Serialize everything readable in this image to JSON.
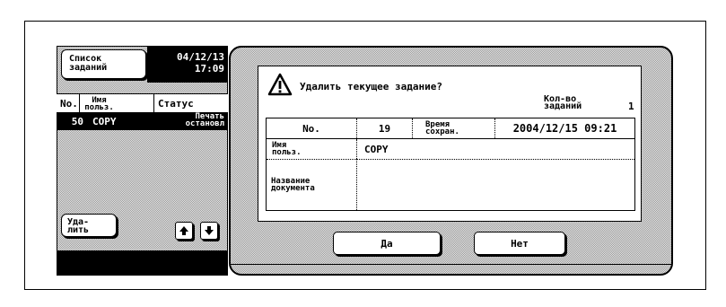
{
  "job_panel": {
    "list_button_line1": "Список",
    "list_button_line2": "заданий",
    "date": "04/12/13",
    "time": "17:09",
    "header": {
      "no": "No.",
      "user_line1": "Имя",
      "user_line2": "польз.",
      "status": "Статус"
    },
    "jobs": [
      {
        "no": "50",
        "user": "COPY",
        "status_line1": "Печать",
        "status_line2": "остановл"
      }
    ],
    "delete_line1": "Уда-",
    "delete_line2": "лить",
    "up_icon": "arrow-up-icon",
    "down_icon": "arrow-down-icon"
  },
  "dialog": {
    "icon": "warning-icon",
    "message": "Удалить текущее задание?",
    "count_label_line1": "Кол-во",
    "count_label_line2": "заданий",
    "count_value": "1",
    "table": {
      "no_label": "No.",
      "no_value": "19",
      "saved_label_line1": "Время",
      "saved_label_line2": "сохран.",
      "saved_value": "2004/12/15 09:21",
      "user_label_line1": "Имя",
      "user_label_line2": "польз.",
      "user_value": "COPY",
      "doc_label_line1": "Название",
      "doc_label_line2": "документа",
      "doc_value": ""
    },
    "yes_label": "Да",
    "no_label": "Нет"
  }
}
